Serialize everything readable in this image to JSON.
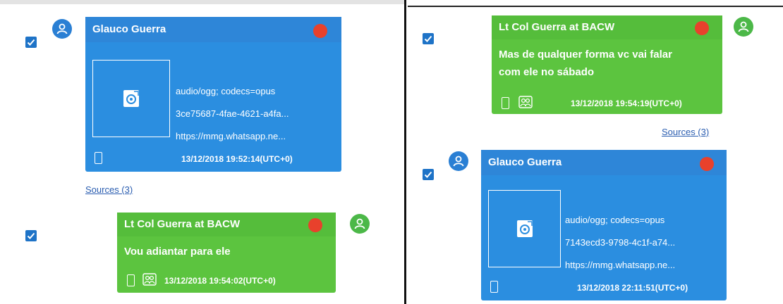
{
  "colors": {
    "blue_bubble": "#2b8ee0",
    "green_bubble": "#5cc43f",
    "status_red": "#e8412c",
    "checkbox": "#1e73c7",
    "link": "#2a5db0"
  },
  "left": {
    "msg1": {
      "sender": "Glauco Guerra",
      "attachment": {
        "mime": "audio/ogg; codecs=opus",
        "id": "3ce75687-4fae-4621-a4fa...",
        "url": "https://mmg.whatsapp.ne..."
      },
      "timestamp": "13/12/2018 19:52:14(UTC+0)",
      "sources": "Sources (3)"
    },
    "msg2": {
      "sender": "Lt Col Guerra at BACW",
      "text": "Vou adiantar para ele",
      "timestamp": "13/12/2018 19:54:02(UTC+0)"
    }
  },
  "right": {
    "msg1": {
      "sender": "Lt Col Guerra at BACW",
      "text_line1": "Mas de qualquer forma vc vai falar",
      "text_line2": "com ele no sábado",
      "timestamp": "13/12/2018 19:54:19(UTC+0)",
      "sources": "Sources (3)"
    },
    "msg2": {
      "sender": "Glauco Guerra",
      "attachment": {
        "mime": "audio/ogg; codecs=opus",
        "id": "7143ecd3-9798-4c1f-a74...",
        "url": "https://mmg.whatsapp.ne..."
      },
      "timestamp": "13/12/2018 22:11:51(UTC+0)"
    }
  }
}
